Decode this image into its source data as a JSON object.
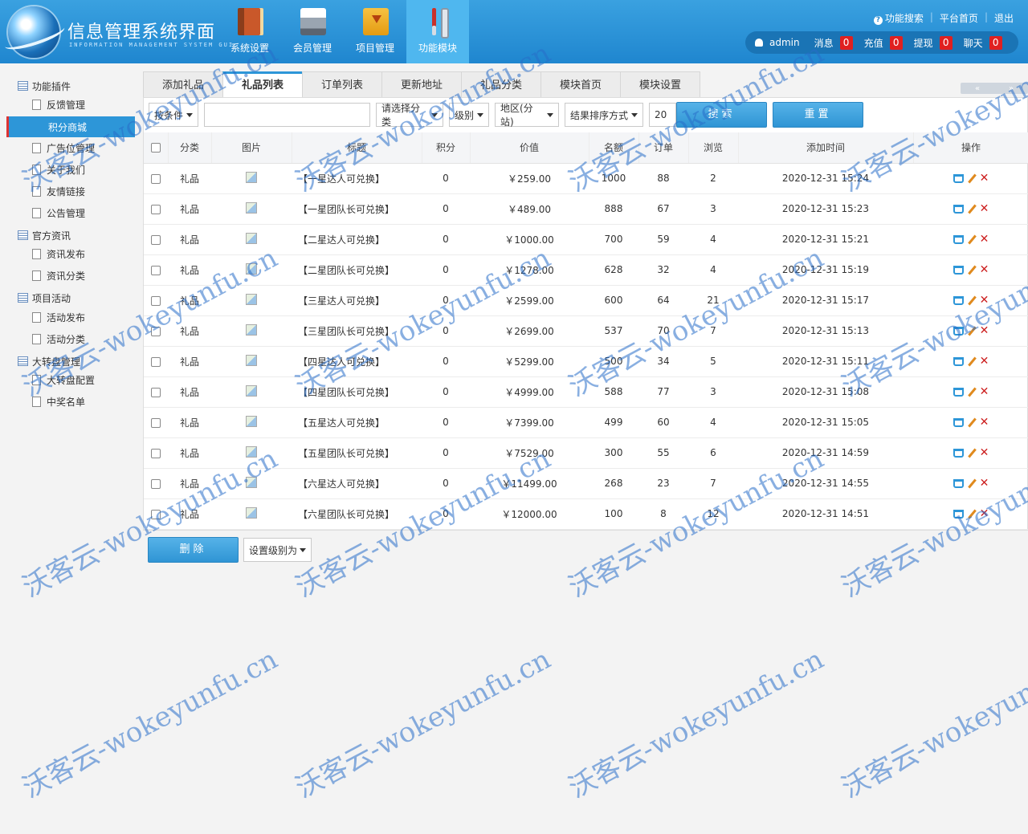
{
  "header": {
    "title": "信息管理系统界面",
    "subtitle": "INFORMATION MANAGEMENT SYSTEM GUI",
    "nav": [
      {
        "label": "系统设置",
        "icon": "book-icon"
      },
      {
        "label": "会员管理",
        "icon": "printer-icon"
      },
      {
        "label": "项目管理",
        "icon": "folder-download-icon"
      },
      {
        "label": "功能模块",
        "icon": "tools-icon",
        "active": true
      }
    ],
    "links": {
      "search": "功能搜索",
      "home": "平台首页",
      "logout": "退出"
    },
    "user": {
      "name": "admin",
      "stats": [
        {
          "label": "消息",
          "count": "0"
        },
        {
          "label": "充值",
          "count": "0"
        },
        {
          "label": "提现",
          "count": "0"
        },
        {
          "label": "聊天",
          "count": "0"
        }
      ]
    }
  },
  "sidebar": {
    "groups": [
      {
        "label": "功能插件",
        "items": [
          "反馈管理",
          "积分商城",
          "广告位管理",
          "关于我们",
          "友情链接",
          "公告管理"
        ]
      },
      {
        "label": "官方资讯",
        "items": [
          "资讯发布",
          "资讯分类"
        ]
      },
      {
        "label": "项目活动",
        "items": [
          "活动发布",
          "活动分类"
        ]
      },
      {
        "label": "大转盘管理",
        "items": [
          "大转盘配置",
          "中奖名单"
        ]
      }
    ],
    "active": "积分商城"
  },
  "tabs": [
    "添加礼品",
    "礼品列表",
    "订单列表",
    "更新地址",
    "礼品分类",
    "模块首页",
    "模块设置"
  ],
  "active_tab": "礼品列表",
  "filters": {
    "condition": "按条件",
    "keyword": "",
    "category": "请选择分类",
    "level": "级别",
    "region": "地区(分站)",
    "sort": "结果排序方式",
    "page_size": "20",
    "search_btn": "搜索",
    "reset_btn": "重置"
  },
  "table": {
    "columns": [
      "分类",
      "图片",
      "标题",
      "积分",
      "价值",
      "名额",
      "订单",
      "浏览",
      "添加时间",
      "操作"
    ],
    "rows": [
      {
        "category": "礼品",
        "title": "【一星达人可兑换】",
        "points": "0",
        "value": "￥259.00",
        "quota": "1000",
        "orders": "88",
        "views": "2",
        "time": "2020-12-31 15:24"
      },
      {
        "category": "礼品",
        "title": "【一星团队长可兑换】",
        "points": "0",
        "value": "￥489.00",
        "quota": "888",
        "orders": "67",
        "views": "3",
        "time": "2020-12-31 15:23"
      },
      {
        "category": "礼品",
        "title": "【二星达人可兑换】",
        "points": "0",
        "value": "￥1000.00",
        "quota": "700",
        "orders": "59",
        "views": "4",
        "time": "2020-12-31 15:21"
      },
      {
        "category": "礼品",
        "title": "【二星团队长可兑换】",
        "points": "0",
        "value": "￥1278.00",
        "quota": "628",
        "orders": "32",
        "views": "4",
        "time": "2020-12-31 15:19"
      },
      {
        "category": "礼品",
        "title": "【三星达人可兑换】",
        "points": "0",
        "value": "￥2599.00",
        "quota": "600",
        "orders": "64",
        "views": "21",
        "time": "2020-12-31 15:17"
      },
      {
        "category": "礼品",
        "title": "【三星团队长可兑换】",
        "points": "0",
        "value": "￥2699.00",
        "quota": "537",
        "orders": "70",
        "views": "7",
        "time": "2020-12-31 15:13"
      },
      {
        "category": "礼品",
        "title": "【四星达人可兑换】",
        "points": "0",
        "value": "￥5299.00",
        "quota": "500",
        "orders": "34",
        "views": "5",
        "time": "2020-12-31 15:11"
      },
      {
        "category": "礼品",
        "title": "【四星团队长可兑换】",
        "points": "0",
        "value": "￥4999.00",
        "quota": "588",
        "orders": "77",
        "views": "3",
        "time": "2020-12-31 15:08"
      },
      {
        "category": "礼品",
        "title": "【五星达人可兑换】",
        "points": "0",
        "value": "￥7399.00",
        "quota": "499",
        "orders": "60",
        "views": "4",
        "time": "2020-12-31 15:05"
      },
      {
        "category": "礼品",
        "title": "【五星团队长可兑换】",
        "points": "0",
        "value": "￥7529.00",
        "quota": "300",
        "orders": "55",
        "views": "6",
        "time": "2020-12-31 14:59"
      },
      {
        "category": "礼品",
        "title": "【六星达人可兑换】",
        "points": "0",
        "value": "￥11499.00",
        "quota": "268",
        "orders": "23",
        "views": "7",
        "time": "2020-12-31 14:55"
      },
      {
        "category": "礼品",
        "title": "【六星团队长可兑换】",
        "points": "0",
        "value": "￥12000.00",
        "quota": "100",
        "orders": "8",
        "views": "12",
        "time": "2020-12-31 14:51"
      }
    ]
  },
  "bottom": {
    "delete_btn": "删除",
    "set_level": "设置级别为"
  },
  "watermark": "沃客云-wokeyunfu.cn",
  "colors": {
    "header_blue": "#1f86cf",
    "accent": "#2d96d8",
    "red": "#c0392b"
  }
}
